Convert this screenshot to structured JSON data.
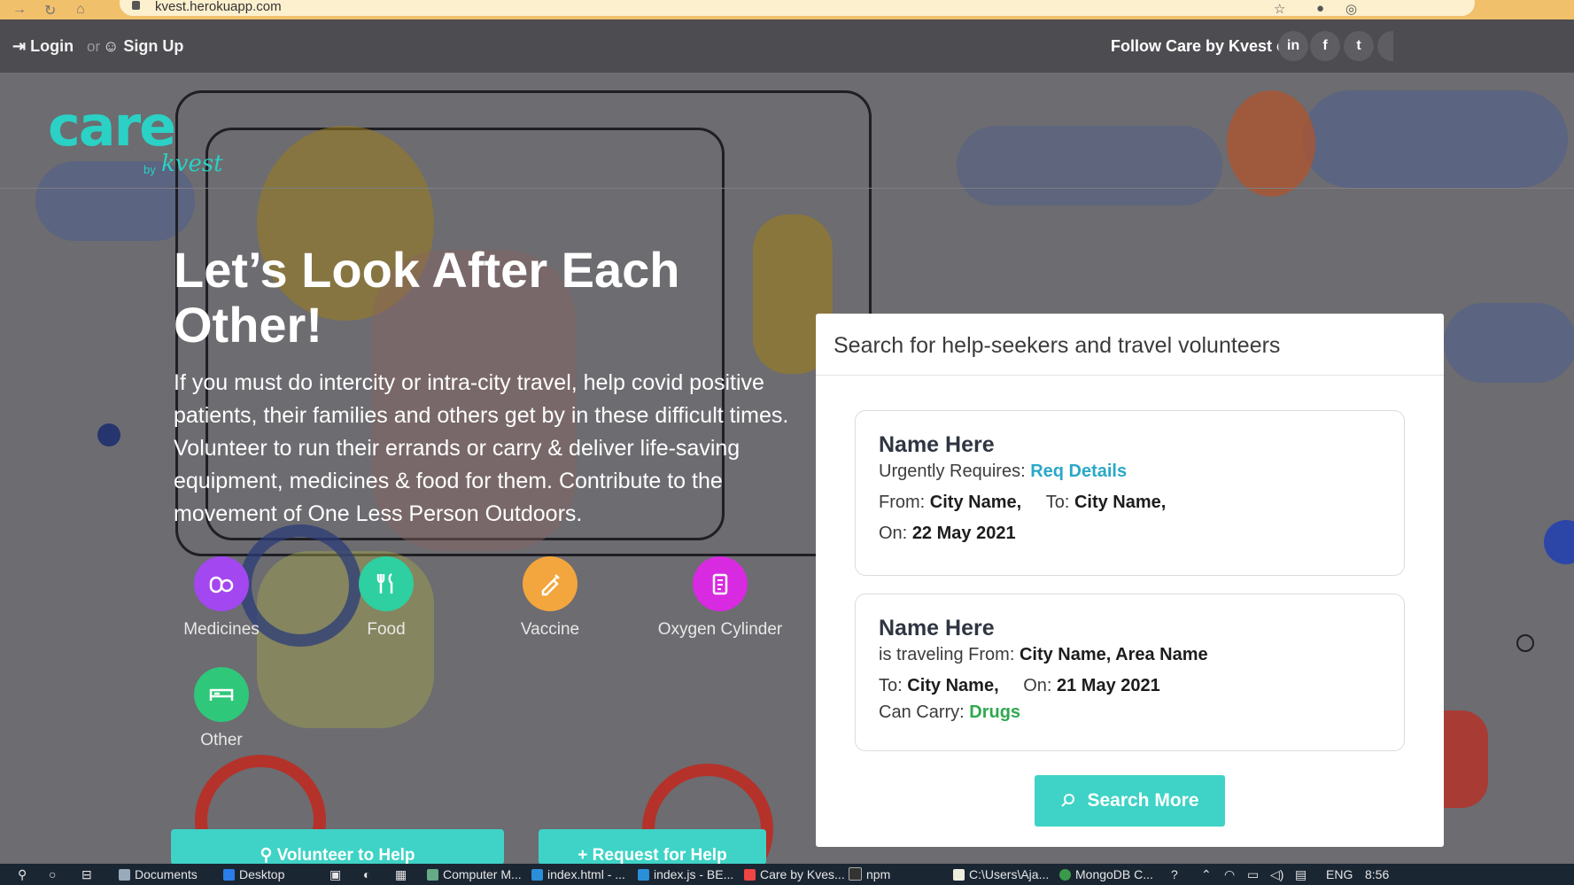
{
  "browser": {
    "url": "kvest.herokuapp.com"
  },
  "topbar": {
    "login": "Login",
    "or": "or",
    "signup": "Sign Up",
    "follow": "Follow Care by Kvest on:",
    "social": [
      "in",
      "f",
      "t"
    ]
  },
  "brand": {
    "name": "care",
    "by": "by",
    "sub": "kvest"
  },
  "hero": {
    "headline": "Let’s Look After Each Other!",
    "description": "If you must do intercity or intra-city travel, help covid positive patients, their families and others get by in these difficult times. Volunteer to run their errands or carry & deliver life-saving equipment, medicines & food for them. Contribute to the movement of One Less Person Outdoors.",
    "categories": [
      {
        "label": "Medicines",
        "color": "#a347f0",
        "icon": "pills-icon"
      },
      {
        "label": "Food",
        "color": "#2ecfa0",
        "icon": "fork-knife-icon"
      },
      {
        "label": "Vaccine",
        "color": "#f3a63d",
        "icon": "syringe-icon"
      },
      {
        "label": "Oxygen Cylinder",
        "color": "#d82ae0",
        "icon": "cylinder-icon"
      },
      {
        "label": "Other",
        "color": "#2fc77a",
        "icon": "bed-icon"
      }
    ],
    "volunteer_btn": "Volunteer to Help",
    "request_btn": "Request for Help"
  },
  "panel": {
    "title": "Search for help-seekers and travel volunteers",
    "card1": {
      "name": "Name Here",
      "requires_label": "Urgently Requires:",
      "requires": "Req Details",
      "from_label": "From:",
      "from": "City Name,",
      "to_label": "To:",
      "to": "City Name,",
      "on_label": "On:",
      "on": "22 May 2021"
    },
    "card2": {
      "name": "Name Here",
      "travel_label": "is traveling From:",
      "travel_from": "City Name, Area Name",
      "to_label": "To:",
      "to": "City Name,",
      "on_label": "On:",
      "on": "21 May 2021",
      "carry_label": "Can Carry:",
      "carry": "Drugs"
    },
    "search_more": "Search More"
  },
  "taskbar": {
    "items": [
      "Documents",
      "Desktop",
      "Computer M...",
      "index.html - ...",
      "index.js - BE...",
      "Care by Kves...",
      "npm",
      "C:\\Users\\Aja...",
      "MongoDB C..."
    ],
    "lang": "ENG",
    "time": "8:56"
  }
}
